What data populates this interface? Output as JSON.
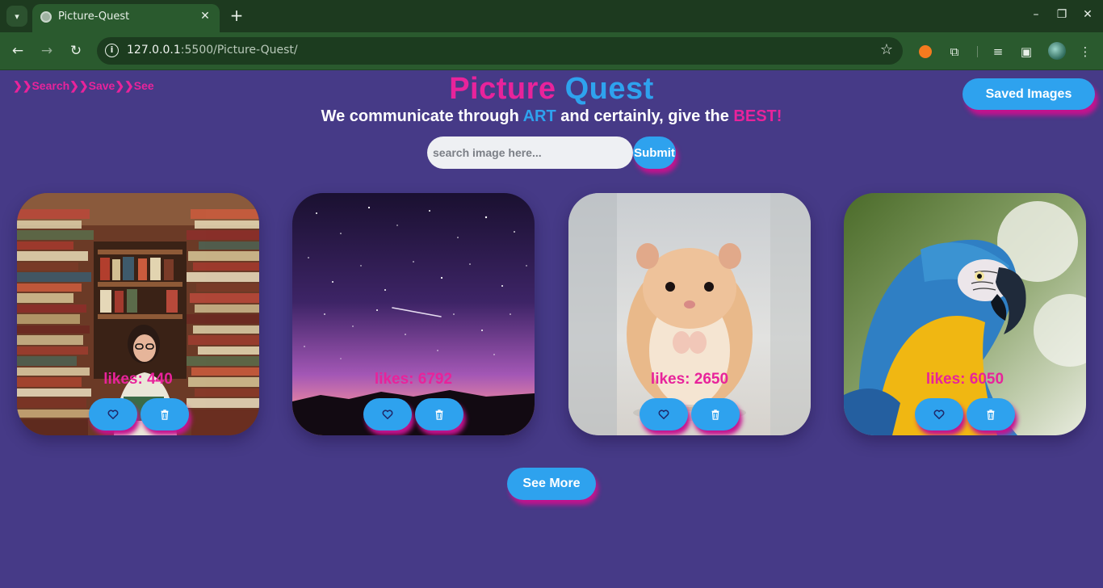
{
  "browser": {
    "tab_title": "Picture-Quest",
    "url_host": "127.0.0.1",
    "url_rest": ":5500/Picture-Quest/"
  },
  "page": {
    "tagline": "❯❯Search❯❯Save❯❯See",
    "title_part1": "Picture",
    "title_part2": "Quest",
    "subtitle_before": "We communicate through ",
    "subtitle_art": "ART",
    "subtitle_middle": " and certainly, give the ",
    "subtitle_best": "BEST!",
    "saved_images_label": "Saved Images",
    "search_placeholder": "search image here...",
    "submit_label": "Submit",
    "see_more_label": "See More"
  },
  "cards": [
    {
      "likes": "likes: 440",
      "subject": "woman reading among stacks of books"
    },
    {
      "likes": "likes: 6792",
      "subject": "starry night sky with shooting star"
    },
    {
      "likes": "likes: 2650",
      "subject": "hamster"
    },
    {
      "likes": "likes: 6050",
      "subject": "blue and yellow macaw"
    }
  ],
  "colors": {
    "background": "#463a87",
    "pink": "#e8239b",
    "blue": "#2ea2ee"
  }
}
